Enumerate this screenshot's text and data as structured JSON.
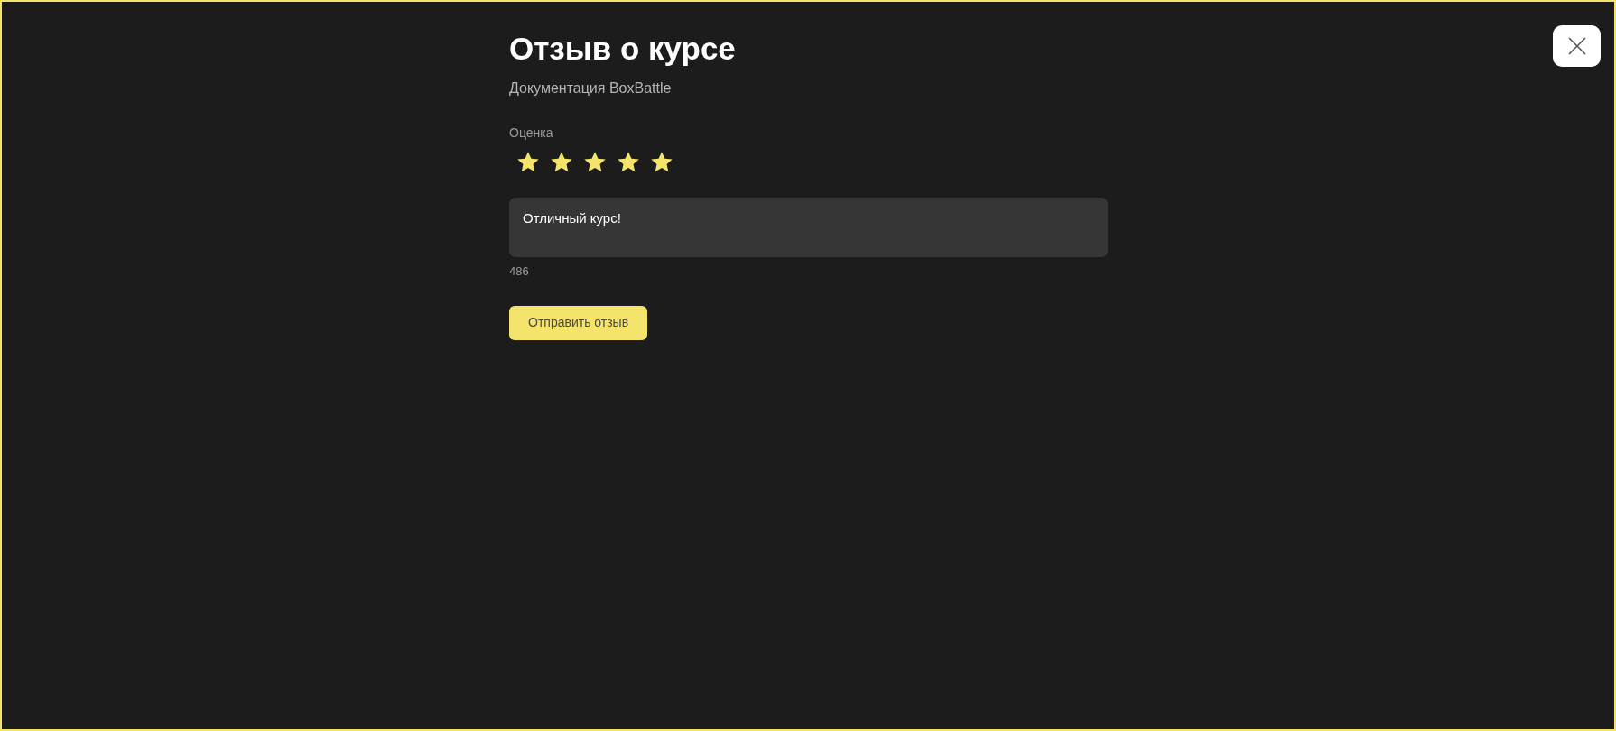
{
  "dialog": {
    "title": "Отзыв о курсе",
    "subtitle": "Документация BoxBattle"
  },
  "rating": {
    "label": "Оценка",
    "stars": 5
  },
  "review": {
    "value": "Отличный курс!",
    "counter": "486"
  },
  "submit_button": "Отправить отзыв"
}
